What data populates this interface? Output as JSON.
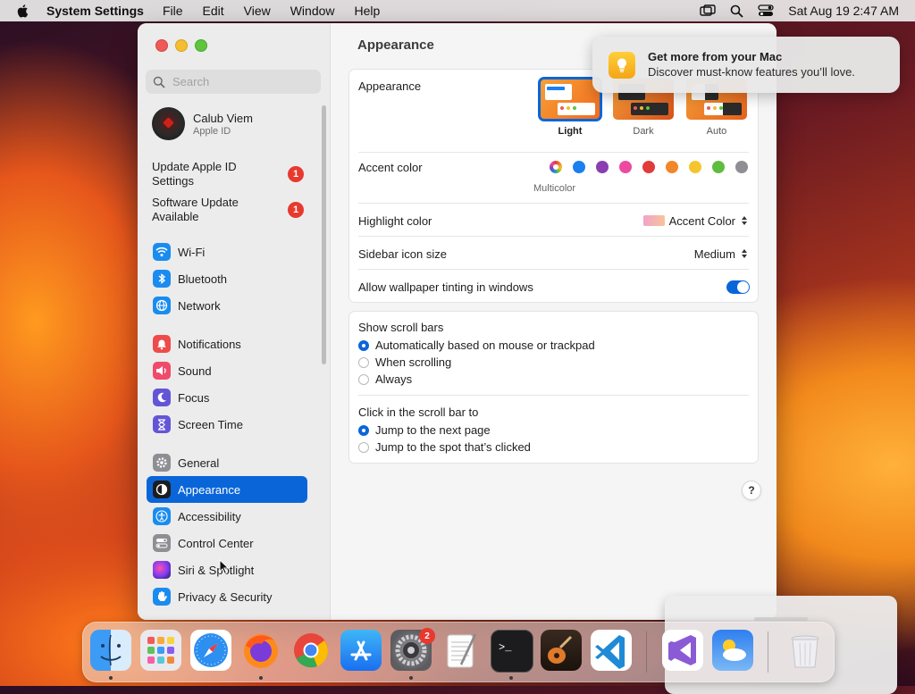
{
  "menubar": {
    "app_name": "System Settings",
    "menus": [
      "File",
      "Edit",
      "View",
      "Window",
      "Help"
    ],
    "clock": "Sat Aug 19  2:47 AM",
    "icons": [
      "screen-mirroring-icon",
      "spotlight-search-icon",
      "control-center-icon"
    ]
  },
  "sidebar": {
    "search_placeholder": "Search",
    "account": {
      "name": "Calub Viem",
      "subtitle": "Apple ID"
    },
    "notices": [
      {
        "label": "Update Apple ID Settings",
        "badge": "1"
      },
      {
        "label": "Software Update Available",
        "badge": "1"
      }
    ],
    "items": [
      {
        "label": "Wi-Fi",
        "icon": "wifi-icon",
        "color": "#1a8cf0"
      },
      {
        "label": "Bluetooth",
        "icon": "bluetooth-icon",
        "color": "#1a8cf0"
      },
      {
        "label": "Network",
        "icon": "globe-icon",
        "color": "#1a8cf0"
      },
      {
        "label": "Notifications",
        "icon": "bell-icon",
        "color": "#ef4b4b"
      },
      {
        "label": "Sound",
        "icon": "speaker-icon",
        "color": "#ef4b6b"
      },
      {
        "label": "Focus",
        "icon": "moon-icon",
        "color": "#6356d6"
      },
      {
        "label": "Screen Time",
        "icon": "hourglass-icon",
        "color": "#6356d6"
      },
      {
        "label": "General",
        "icon": "gear-icon",
        "color": "#8e8e93"
      },
      {
        "label": "Appearance",
        "icon": "appearance-icon",
        "color": "#1d1d1f",
        "selected": true
      },
      {
        "label": "Accessibility",
        "icon": "accessibility-icon",
        "color": "#1a8cf0"
      },
      {
        "label": "Control Center",
        "icon": "switches-icon",
        "color": "#8e8e93"
      },
      {
        "label": "Siri & Spotlight",
        "icon": "siri-icon",
        "color": "#9a3ff0"
      },
      {
        "label": "Privacy & Security",
        "icon": "hand-icon",
        "color": "#1a8cf0"
      }
    ]
  },
  "content": {
    "title": "Appearance",
    "appearance_label": "Appearance",
    "themes": [
      {
        "label": "Light",
        "selected": true
      },
      {
        "label": "Dark",
        "selected": false
      },
      {
        "label": "Auto",
        "selected": false
      }
    ],
    "accent_label": "Accent color",
    "accent_colors": [
      "multicolor",
      "#1a7ff0",
      "#8a3eb0",
      "#ec4aa0",
      "#e23c3a",
      "#f2872a",
      "#f6c52e",
      "#5ebd3e",
      "#8e8e93"
    ],
    "accent_selected_name": "Multicolor",
    "highlight_label": "Highlight color",
    "highlight_value": "Accent Color",
    "icon_size_label": "Sidebar icon size",
    "icon_size_value": "Medium",
    "tinting_label": "Allow wallpaper tinting in windows",
    "tinting_on": true,
    "scroll_bars_label": "Show scroll bars",
    "scroll_bar_options": [
      {
        "label": "Automatically based on mouse or trackpad",
        "selected": true
      },
      {
        "label": "When scrolling",
        "selected": false
      },
      {
        "label": "Always",
        "selected": false
      }
    ],
    "click_label": "Click in the scroll bar to",
    "click_options": [
      {
        "label": "Jump to the next page",
        "selected": true
      },
      {
        "label": "Jump to the spot that’s clicked",
        "selected": false
      }
    ],
    "help": "?"
  },
  "notification": {
    "title": "Get more from your Mac",
    "body": "Discover must-know features you’ll love.",
    "icon": "lightbulb-icon"
  },
  "dock": {
    "apps": [
      {
        "name": "finder",
        "running": true
      },
      {
        "name": "launchpad",
        "running": false
      },
      {
        "name": "safari",
        "running": false
      },
      {
        "name": "firefox",
        "running": true
      },
      {
        "name": "chrome",
        "running": false
      },
      {
        "name": "app-store",
        "running": false
      },
      {
        "name": "system-settings",
        "running": true,
        "badge": "2"
      },
      {
        "name": "textedit",
        "running": false
      },
      {
        "name": "terminal",
        "running": true
      },
      {
        "name": "garageband",
        "running": false
      },
      {
        "name": "vscode",
        "running": false
      },
      {
        "name": "visual-studio",
        "running": false
      },
      {
        "name": "weather",
        "running": false
      },
      {
        "name": "trash",
        "running": false
      }
    ]
  }
}
